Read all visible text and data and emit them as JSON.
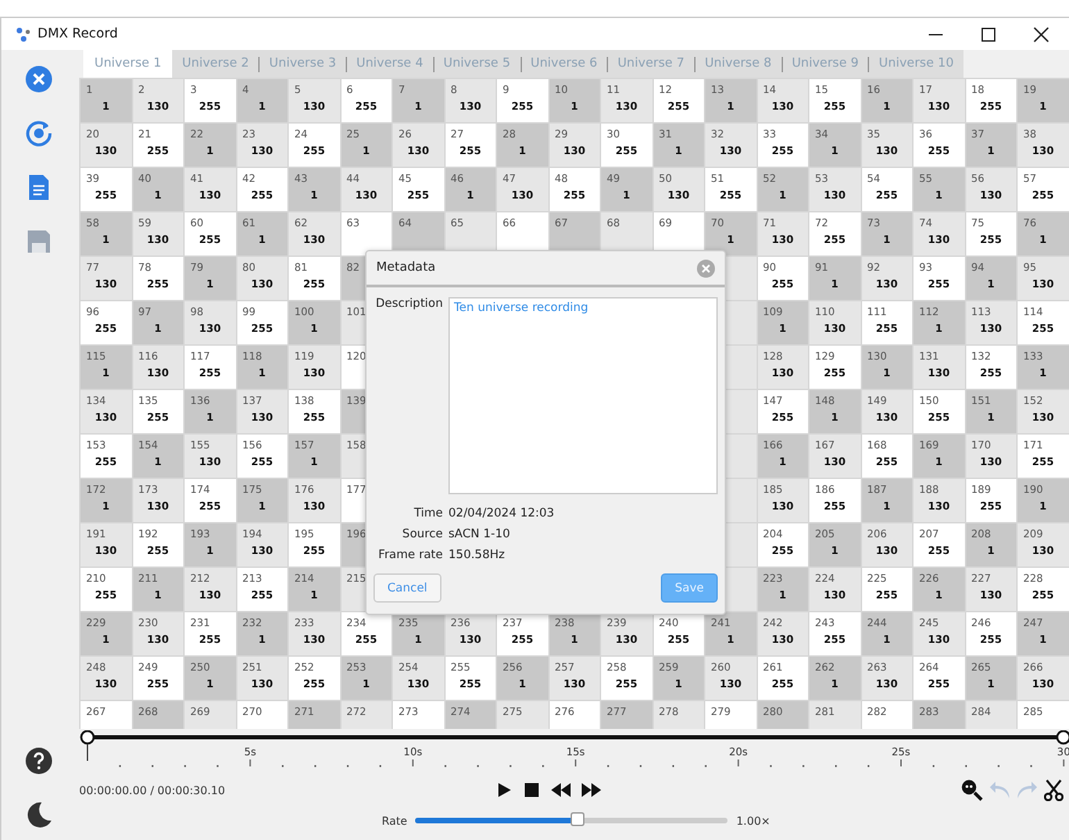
{
  "window": {
    "title": "DMX Record"
  },
  "sidebar": [
    {
      "kind": "close",
      "disabled": false
    },
    {
      "kind": "record",
      "disabled": false
    },
    {
      "kind": "document",
      "disabled": false
    },
    {
      "kind": "save",
      "disabled": true
    }
  ],
  "sidebar_bottom": [
    {
      "kind": "help"
    },
    {
      "kind": "theme"
    }
  ],
  "tabs": [
    {
      "label": "Universe 1",
      "selected": true
    },
    {
      "label": "Universe 2",
      "selected": false
    },
    {
      "label": "Universe 3",
      "selected": false
    },
    {
      "label": "Universe 4",
      "selected": false
    },
    {
      "label": "Universe 5",
      "selected": false
    },
    {
      "label": "Universe 6",
      "selected": false
    },
    {
      "label": "Universe 7",
      "selected": false
    },
    {
      "label": "Universe 8",
      "selected": false
    },
    {
      "label": "Universe 9",
      "selected": false
    },
    {
      "label": "Universe 10",
      "selected": false
    }
  ],
  "grid": {
    "rows": [
      [
        {
          "ch": "1",
          "v": "1",
          "color": "#c8c8c8"
        },
        {
          "ch": "2",
          "v": "130",
          "color": "#e6e6e6"
        },
        {
          "ch": "3",
          "v": "255",
          "color": "#ffffff"
        },
        {
          "ch": "4",
          "v": "1",
          "color": "#c8c8c8"
        },
        {
          "ch": "5",
          "v": "130",
          "color": "#e6e6e6"
        },
        {
          "ch": "6",
          "v": "255",
          "color": "#ffffff"
        },
        {
          "ch": "7",
          "v": "1",
          "color": "#c8c8c8"
        },
        {
          "ch": "8",
          "v": "130",
          "color": "#e6e6e6"
        },
        {
          "ch": "9",
          "v": "255",
          "color": "#ffffff"
        },
        {
          "ch": "10",
          "v": "1",
          "color": "#c8c8c8"
        },
        {
          "ch": "11",
          "v": "130",
          "color": "#e6e6e6"
        },
        {
          "ch": "12",
          "v": "255",
          "color": "#ffffff"
        },
        {
          "ch": "13",
          "v": "1",
          "color": "#c8c8c8"
        },
        {
          "ch": "14",
          "v": "130",
          "color": "#e6e6e6"
        },
        {
          "ch": "15",
          "v": "255",
          "color": "#ffffff"
        },
        {
          "ch": "16",
          "v": "1",
          "color": "#c8c8c8"
        },
        {
          "ch": "17",
          "v": "130",
          "color": "#e6e6e6"
        },
        {
          "ch": "18",
          "v": "255",
          "color": "#ffffff"
        },
        {
          "ch": "19",
          "v": "1",
          "color": "#c8c8c8"
        }
      ],
      [
        {
          "ch": "20",
          "v": "130",
          "color": "#e6e6e6"
        },
        {
          "ch": "21",
          "v": "255",
          "color": "#ffffff"
        },
        {
          "ch": "22",
          "v": "1",
          "color": "#c8c8c8"
        },
        {
          "ch": "23",
          "v": "130",
          "color": "#e6e6e6"
        },
        {
          "ch": "24",
          "v": "255",
          "color": "#ffffff"
        },
        {
          "ch": "25",
          "v": "1",
          "color": "#c8c8c8"
        },
        {
          "ch": "26",
          "v": "130",
          "color": "#e6e6e6"
        },
        {
          "ch": "27",
          "v": "255",
          "color": "#ffffff"
        },
        {
          "ch": "28",
          "v": "1",
          "color": "#c8c8c8"
        },
        {
          "ch": "29",
          "v": "130",
          "color": "#e6e6e6"
        },
        {
          "ch": "30",
          "v": "255",
          "color": "#ffffff"
        },
        {
          "ch": "31",
          "v": "1",
          "color": "#c8c8c8"
        },
        {
          "ch": "32",
          "v": "130",
          "color": "#e6e6e6"
        },
        {
          "ch": "33",
          "v": "255",
          "color": "#ffffff"
        },
        {
          "ch": "34",
          "v": "1",
          "color": "#c8c8c8"
        },
        {
          "ch": "35",
          "v": "130",
          "color": "#e6e6e6"
        },
        {
          "ch": "36",
          "v": "255",
          "color": "#ffffff"
        },
        {
          "ch": "37",
          "v": "1",
          "color": "#c8c8c8"
        },
        {
          "ch": "38",
          "v": "130",
          "color": "#e6e6e6"
        }
      ],
      [
        {
          "ch": "39",
          "v": "255",
          "color": "#ffffff"
        },
        {
          "ch": "40",
          "v": "1",
          "color": "#c8c8c8"
        },
        {
          "ch": "41",
          "v": "130",
          "color": "#e6e6e6"
        },
        {
          "ch": "42",
          "v": "255",
          "color": "#ffffff"
        },
        {
          "ch": "43",
          "v": "1",
          "color": "#c8c8c8"
        },
        {
          "ch": "44",
          "v": "130",
          "color": "#e6e6e6"
        },
        {
          "ch": "45",
          "v": "255",
          "color": "#ffffff"
        },
        {
          "ch": "46",
          "v": "1",
          "color": "#c8c8c8"
        },
        {
          "ch": "47",
          "v": "130",
          "color": "#e6e6e6"
        },
        {
          "ch": "48",
          "v": "255",
          "color": "#ffffff"
        },
        {
          "ch": "49",
          "v": "1",
          "color": "#c8c8c8"
        },
        {
          "ch": "50",
          "v": "130",
          "color": "#e6e6e6"
        },
        {
          "ch": "51",
          "v": "255",
          "color": "#ffffff"
        },
        {
          "ch": "52",
          "v": "1",
          "color": "#c8c8c8"
        },
        {
          "ch": "53",
          "v": "130",
          "color": "#e6e6e6"
        },
        {
          "ch": "54",
          "v": "255",
          "color": "#ffffff"
        },
        {
          "ch": "55",
          "v": "1",
          "color": "#c8c8c8"
        },
        {
          "ch": "56",
          "v": "130",
          "color": "#e6e6e6"
        },
        {
          "ch": "57",
          "v": "255",
          "color": "#ffffff"
        }
      ],
      [
        {
          "ch": "58",
          "v": "1",
          "color": "#c8c8c8"
        },
        {
          "ch": "59",
          "v": "130",
          "color": "#e6e6e6"
        },
        {
          "ch": "60",
          "v": "255",
          "color": "#ffffff"
        },
        {
          "ch": "61",
          "v": "1",
          "color": "#c8c8c8"
        },
        {
          "ch": "62",
          "v": "130",
          "color": "#e6e6e6"
        },
        {
          "ch": "63",
          "color": "#ffffff"
        },
        {
          "ch": "64",
          "color": "#c8c8c8"
        },
        {
          "ch": "65",
          "color": "#e6e6e6"
        },
        {
          "ch": "66",
          "color": "#ffffff"
        },
        {
          "ch": "67",
          "color": "#c8c8c8"
        },
        {
          "ch": "68",
          "color": "#e6e6e6"
        },
        {
          "ch": "69",
          "color": "#ffffff"
        },
        {
          "ch": "70",
          "v": "1",
          "color": "#c8c8c8"
        },
        {
          "ch": "71",
          "v": "130",
          "color": "#e6e6e6"
        },
        {
          "ch": "72",
          "v": "255",
          "color": "#ffffff"
        },
        {
          "ch": "73",
          "v": "1",
          "color": "#c8c8c8"
        },
        {
          "ch": "74",
          "v": "130",
          "color": "#e6e6e6"
        },
        {
          "ch": "75",
          "v": "255",
          "color": "#ffffff"
        },
        {
          "ch": "76",
          "v": "1",
          "color": "#c8c8c8"
        }
      ],
      [
        {
          "ch": "77",
          "v": "130",
          "color": "#e6e6e6"
        },
        {
          "ch": "78",
          "v": "255",
          "color": "#ffffff"
        },
        {
          "ch": "79",
          "v": "1",
          "color": "#c8c8c8"
        },
        {
          "ch": "80",
          "v": "130",
          "color": "#e6e6e6"
        },
        {
          "ch": "81",
          "v": "255",
          "color": "#ffffff"
        },
        {
          "ch": "82",
          "color": "#c8c8c8"
        },
        {},
        {},
        {},
        {},
        {},
        {},
        {},
        {
          "ch": "90",
          "v": "255",
          "color": "#ffffff"
        },
        {
          "ch": "91",
          "v": "1",
          "color": "#c8c8c8"
        },
        {
          "ch": "92",
          "v": "130",
          "color": "#e6e6e6"
        },
        {
          "ch": "93",
          "v": "255",
          "color": "#ffffff"
        },
        {
          "ch": "94",
          "v": "1",
          "color": "#c8c8c8"
        },
        {
          "ch": "95",
          "v": "130",
          "color": "#e6e6e6"
        }
      ],
      [
        {
          "ch": "96",
          "v": "255",
          "color": "#ffffff"
        },
        {
          "ch": "97",
          "v": "1",
          "color": "#c8c8c8"
        },
        {
          "ch": "98",
          "v": "130",
          "color": "#e6e6e6"
        },
        {
          "ch": "99",
          "v": "255",
          "color": "#ffffff"
        },
        {
          "ch": "100",
          "v": "1",
          "color": "#c8c8c8"
        },
        {
          "ch": "101",
          "color": "#e6e6e6"
        },
        {},
        {},
        {},
        {},
        {},
        {},
        {},
        {
          "ch": "109",
          "v": "1",
          "color": "#c8c8c8"
        },
        {
          "ch": "110",
          "v": "130",
          "color": "#e6e6e6"
        },
        {
          "ch": "111",
          "v": "255",
          "color": "#ffffff"
        },
        {
          "ch": "112",
          "v": "1",
          "color": "#c8c8c8"
        },
        {
          "ch": "113",
          "v": "130",
          "color": "#e6e6e6"
        },
        {
          "ch": "114",
          "v": "255",
          "color": "#ffffff"
        }
      ],
      [
        {
          "ch": "115",
          "v": "1",
          "color": "#c8c8c8"
        },
        {
          "ch": "116",
          "v": "130",
          "color": "#e6e6e6"
        },
        {
          "ch": "117",
          "v": "255",
          "color": "#ffffff"
        },
        {
          "ch": "118",
          "v": "1",
          "color": "#c8c8c8"
        },
        {
          "ch": "119",
          "v": "130",
          "color": "#e6e6e6"
        },
        {
          "ch": "120",
          "color": "#ffffff"
        },
        {},
        {},
        {},
        {},
        {},
        {},
        {},
        {
          "ch": "128",
          "v": "130",
          "color": "#e6e6e6"
        },
        {
          "ch": "129",
          "v": "255",
          "color": "#ffffff"
        },
        {
          "ch": "130",
          "v": "1",
          "color": "#c8c8c8"
        },
        {
          "ch": "131",
          "v": "130",
          "color": "#e6e6e6"
        },
        {
          "ch": "132",
          "v": "255",
          "color": "#ffffff"
        },
        {
          "ch": "133",
          "v": "1",
          "color": "#c8c8c8"
        }
      ],
      [
        {
          "ch": "134",
          "v": "130",
          "color": "#e6e6e6"
        },
        {
          "ch": "135",
          "v": "255",
          "color": "#ffffff"
        },
        {
          "ch": "136",
          "v": "1",
          "color": "#c8c8c8"
        },
        {
          "ch": "137",
          "v": "130",
          "color": "#e6e6e6"
        },
        {
          "ch": "138",
          "v": "255",
          "color": "#ffffff"
        },
        {
          "ch": "139",
          "color": "#c8c8c8"
        },
        {},
        {},
        {},
        {},
        {},
        {},
        {},
        {
          "ch": "147",
          "v": "255",
          "color": "#ffffff"
        },
        {
          "ch": "148",
          "v": "1",
          "color": "#c8c8c8"
        },
        {
          "ch": "149",
          "v": "130",
          "color": "#e6e6e6"
        },
        {
          "ch": "150",
          "v": "255",
          "color": "#ffffff"
        },
        {
          "ch": "151",
          "v": "1",
          "color": "#c8c8c8"
        },
        {
          "ch": "152",
          "v": "130",
          "color": "#e6e6e6"
        }
      ],
      [
        {
          "ch": "153",
          "v": "255",
          "color": "#ffffff"
        },
        {
          "ch": "154",
          "v": "1",
          "color": "#c8c8c8"
        },
        {
          "ch": "155",
          "v": "130",
          "color": "#e6e6e6"
        },
        {
          "ch": "156",
          "v": "255",
          "color": "#ffffff"
        },
        {
          "ch": "157",
          "v": "1",
          "color": "#c8c8c8"
        },
        {
          "ch": "158",
          "color": "#e6e6e6"
        },
        {},
        {},
        {},
        {},
        {},
        {},
        {},
        {
          "ch": "166",
          "v": "1",
          "color": "#c8c8c8"
        },
        {
          "ch": "167",
          "v": "130",
          "color": "#e6e6e6"
        },
        {
          "ch": "168",
          "v": "255",
          "color": "#ffffff"
        },
        {
          "ch": "169",
          "v": "1",
          "color": "#c8c8c8"
        },
        {
          "ch": "170",
          "v": "130",
          "color": "#e6e6e6"
        },
        {
          "ch": "171",
          "v": "255",
          "color": "#ffffff"
        }
      ],
      [
        {
          "ch": "172",
          "v": "1",
          "color": "#c8c8c8"
        },
        {
          "ch": "173",
          "v": "130",
          "color": "#e6e6e6"
        },
        {
          "ch": "174",
          "v": "255",
          "color": "#ffffff"
        },
        {
          "ch": "175",
          "v": "1",
          "color": "#c8c8c8"
        },
        {
          "ch": "176",
          "v": "130",
          "color": "#e6e6e6"
        },
        {
          "ch": "177",
          "color": "#ffffff"
        },
        {},
        {},
        {},
        {},
        {},
        {},
        {},
        {
          "ch": "185",
          "v": "130",
          "color": "#e6e6e6"
        },
        {
          "ch": "186",
          "v": "255",
          "color": "#ffffff"
        },
        {
          "ch": "187",
          "v": "1",
          "color": "#c8c8c8"
        },
        {
          "ch": "188",
          "v": "130",
          "color": "#e6e6e6"
        },
        {
          "ch": "189",
          "v": "255",
          "color": "#ffffff"
        },
        {
          "ch": "190",
          "v": "1",
          "color": "#c8c8c8"
        }
      ],
      [
        {
          "ch": "191",
          "v": "130",
          "color": "#e6e6e6"
        },
        {
          "ch": "192",
          "v": "255",
          "color": "#ffffff"
        },
        {
          "ch": "193",
          "v": "1",
          "color": "#c8c8c8"
        },
        {
          "ch": "194",
          "v": "130",
          "color": "#e6e6e6"
        },
        {
          "ch": "195",
          "v": "255",
          "color": "#ffffff"
        },
        {
          "ch": "196",
          "color": "#c8c8c8"
        },
        {},
        {},
        {},
        {},
        {},
        {},
        {},
        {
          "ch": "204",
          "v": "255",
          "color": "#ffffff"
        },
        {
          "ch": "205",
          "v": "1",
          "color": "#c8c8c8"
        },
        {
          "ch": "206",
          "v": "130",
          "color": "#e6e6e6"
        },
        {
          "ch": "207",
          "v": "255",
          "color": "#ffffff"
        },
        {
          "ch": "208",
          "v": "1",
          "color": "#c8c8c8"
        },
        {
          "ch": "209",
          "v": "130",
          "color": "#e6e6e6"
        }
      ],
      [
        {
          "ch": "210",
          "v": "255",
          "color": "#ffffff"
        },
        {
          "ch": "211",
          "v": "1",
          "color": "#c8c8c8"
        },
        {
          "ch": "212",
          "v": "130",
          "color": "#e6e6e6"
        },
        {
          "ch": "213",
          "v": "255",
          "color": "#ffffff"
        },
        {
          "ch": "214",
          "v": "1",
          "color": "#c8c8c8"
        },
        {
          "ch": "215",
          "color": "#e6e6e6"
        },
        {},
        {},
        {},
        {},
        {},
        {},
        {},
        {
          "ch": "223",
          "v": "1",
          "color": "#c8c8c8"
        },
        {
          "ch": "224",
          "v": "130",
          "color": "#e6e6e6"
        },
        {
          "ch": "225",
          "v": "255",
          "color": "#ffffff"
        },
        {
          "ch": "226",
          "v": "1",
          "color": "#c8c8c8"
        },
        {
          "ch": "227",
          "v": "130",
          "color": "#e6e6e6"
        },
        {
          "ch": "228",
          "v": "255",
          "color": "#ffffff"
        }
      ],
      [
        {
          "ch": "229",
          "v": "1",
          "color": "#c8c8c8"
        },
        {
          "ch": "230",
          "v": "130",
          "color": "#e6e6e6"
        },
        {
          "ch": "231",
          "v": "255",
          "color": "#ffffff"
        },
        {
          "ch": "232",
          "v": "1",
          "color": "#c8c8c8"
        },
        {
          "ch": "233",
          "v": "130",
          "color": "#e6e6e6"
        },
        {
          "ch": "234",
          "v": "255",
          "color": "#ffffff"
        },
        {
          "ch": "235",
          "v": "1",
          "color": "#c8c8c8"
        },
        {
          "ch": "236",
          "v": "130",
          "color": "#e6e6e6"
        },
        {
          "ch": "237",
          "v": "255",
          "color": "#ffffff"
        },
        {
          "ch": "238",
          "v": "1",
          "color": "#c8c8c8"
        },
        {
          "ch": "239",
          "v": "130",
          "color": "#e6e6e6"
        },
        {
          "ch": "240",
          "v": "255",
          "color": "#ffffff"
        },
        {
          "ch": "241",
          "v": "1",
          "color": "#c8c8c8"
        },
        {
          "ch": "242",
          "v": "130",
          "color": "#e6e6e6"
        },
        {
          "ch": "243",
          "v": "255",
          "color": "#ffffff"
        },
        {
          "ch": "244",
          "v": "1",
          "color": "#c8c8c8"
        },
        {
          "ch": "245",
          "v": "130",
          "color": "#e6e6e6"
        },
        {
          "ch": "246",
          "v": "255",
          "color": "#ffffff"
        },
        {
          "ch": "247",
          "v": "1",
          "color": "#c8c8c8"
        }
      ],
      [
        {
          "ch": "248",
          "v": "130",
          "color": "#e6e6e6"
        },
        {
          "ch": "249",
          "v": "255",
          "color": "#ffffff"
        },
        {
          "ch": "250",
          "v": "1",
          "color": "#c8c8c8"
        },
        {
          "ch": "251",
          "v": "130",
          "color": "#e6e6e6"
        },
        {
          "ch": "252",
          "v": "255",
          "color": "#ffffff"
        },
        {
          "ch": "253",
          "v": "1",
          "color": "#c8c8c8"
        },
        {
          "ch": "254",
          "v": "130",
          "color": "#e6e6e6"
        },
        {
          "ch": "255",
          "v": "255",
          "color": "#ffffff"
        },
        {
          "ch": "256",
          "v": "1",
          "color": "#c8c8c8"
        },
        {
          "ch": "257",
          "v": "130",
          "color": "#e6e6e6"
        },
        {
          "ch": "258",
          "v": "255",
          "color": "#ffffff"
        },
        {
          "ch": "259",
          "v": "1",
          "color": "#c8c8c8"
        },
        {
          "ch": "260",
          "v": "130",
          "color": "#e6e6e6"
        },
        {
          "ch": "261",
          "v": "255",
          "color": "#ffffff"
        },
        {
          "ch": "262",
          "v": "1",
          "color": "#c8c8c8"
        },
        {
          "ch": "263",
          "v": "130",
          "color": "#e6e6e6"
        },
        {
          "ch": "264",
          "v": "255",
          "color": "#ffffff"
        },
        {
          "ch": "265",
          "v": "1",
          "color": "#c8c8c8"
        },
        {
          "ch": "266",
          "v": "130",
          "color": "#e6e6e6"
        }
      ],
      [
        {
          "ch": "267",
          "color": "#ffffff"
        },
        {
          "ch": "268",
          "color": "#c8c8c8"
        },
        {
          "ch": "269",
          "color": "#e6e6e6"
        },
        {
          "ch": "270",
          "color": "#ffffff"
        },
        {
          "ch": "271",
          "color": "#c8c8c8"
        },
        {
          "ch": "272",
          "color": "#e6e6e6"
        },
        {
          "ch": "273",
          "color": "#ffffff"
        },
        {
          "ch": "274",
          "color": "#c8c8c8"
        },
        {
          "ch": "275",
          "color": "#e6e6e6"
        },
        {
          "ch": "276",
          "color": "#ffffff"
        },
        {
          "ch": "277",
          "color": "#c8c8c8"
        },
        {
          "ch": "278",
          "color": "#e6e6e6"
        },
        {
          "ch": "279",
          "color": "#ffffff"
        },
        {
          "ch": "280",
          "color": "#c8c8c8"
        },
        {
          "ch": "281",
          "color": "#e6e6e6"
        },
        {
          "ch": "282",
          "color": "#ffffff"
        },
        {
          "ch": "283",
          "color": "#c8c8c8"
        },
        {
          "ch": "284",
          "color": "#e6e6e6"
        },
        {
          "ch": "285",
          "color": "#ffffff"
        }
      ]
    ]
  },
  "dialog": {
    "title": "Metadata",
    "description_label": "Description",
    "description": "Ten universe recording",
    "fields": [
      {
        "label": "Time",
        "value": "02/04/2024 12:03"
      },
      {
        "label": "Source",
        "value": "sACN 1-10"
      },
      {
        "label": "Frame rate",
        "value": "150.58Hz"
      }
    ],
    "cancel": "Cancel",
    "save": "Save"
  },
  "timeline": {
    "handles": [
      {
        "level": 0
      },
      {
        "level": 1
      }
    ],
    "ticks": [
      "5s",
      "10s",
      "15s",
      "20s",
      "25s",
      "30"
    ],
    "time": "00:00:00.00 / 00:00:30.10"
  },
  "transport": [
    {
      "kind": "play"
    },
    {
      "kind": "stop"
    },
    {
      "kind": "rewind"
    },
    {
      "kind": "forward"
    }
  ],
  "tools": [
    {
      "kind": "zoom",
      "disabled": false
    },
    {
      "kind": "undo",
      "disabled": true
    },
    {
      "kind": "redo",
      "disabled": true
    },
    {
      "kind": "cut",
      "disabled": false
    }
  ],
  "rate": {
    "label": "Rate",
    "level": 0.52,
    "reading": "1.00×"
  }
}
